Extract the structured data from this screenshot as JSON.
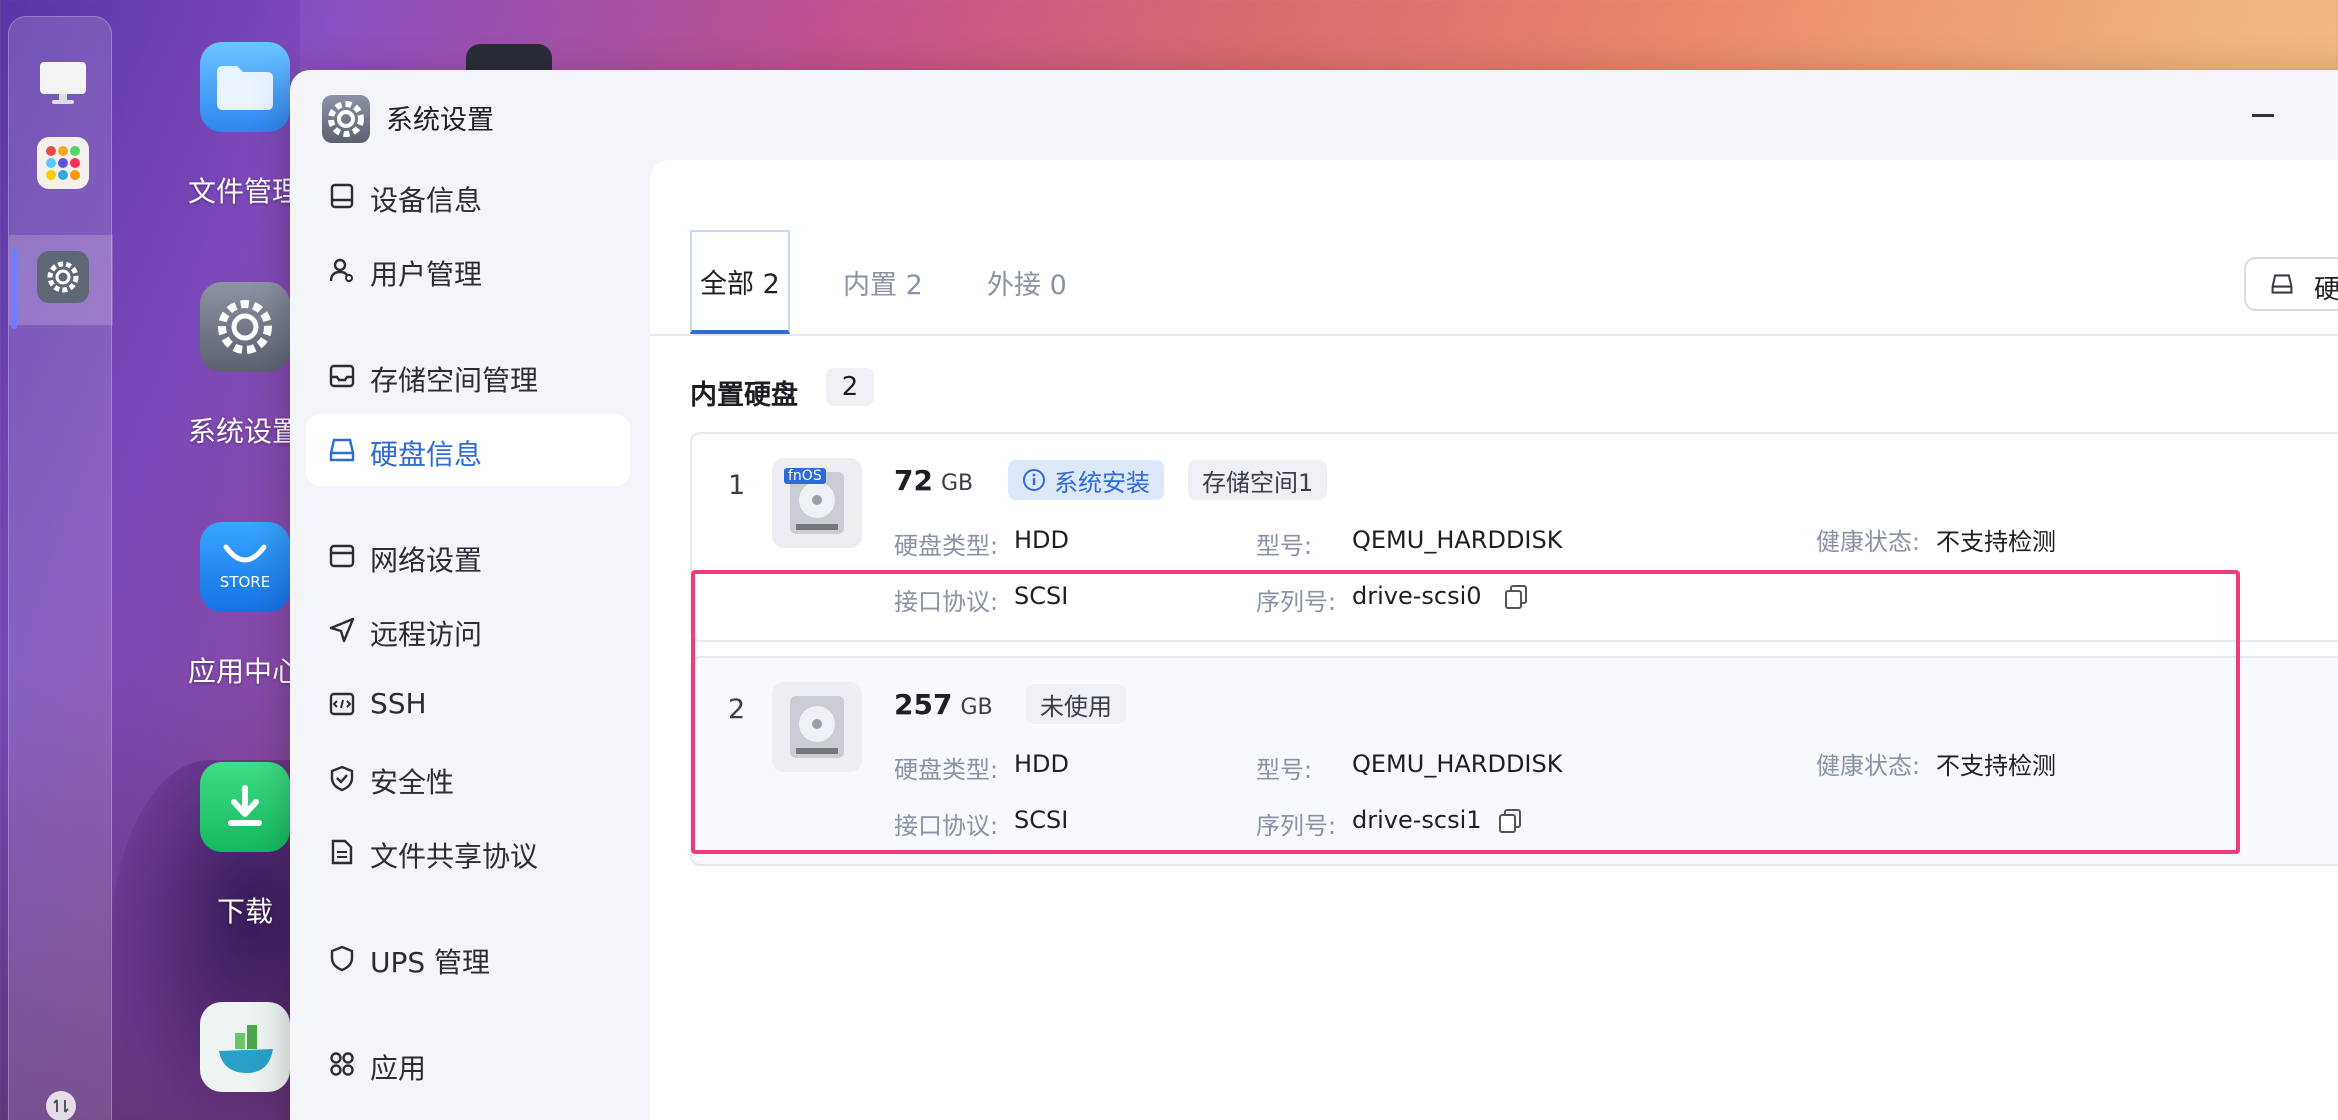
{
  "desktop": {
    "icons": [
      {
        "name": "file-manager",
        "label": "文件管理"
      },
      {
        "name": "system-settings",
        "label": "系统设置"
      },
      {
        "name": "app-center",
        "label": "应用中心",
        "badge": "STORE"
      },
      {
        "name": "download",
        "label": "下载"
      }
    ]
  },
  "window": {
    "title": "系统设置",
    "sidebar": [
      {
        "label": "设备信息",
        "icon": "device-icon"
      },
      {
        "label": "用户管理",
        "icon": "user-icon"
      },
      {
        "label": "存储空间管理",
        "icon": "storage-icon"
      },
      {
        "label": "硬盘信息",
        "icon": "disk-icon",
        "active": true
      },
      {
        "label": "网络设置",
        "icon": "network-icon"
      },
      {
        "label": "远程访问",
        "icon": "send-icon"
      },
      {
        "label": "SSH",
        "icon": "code-icon"
      },
      {
        "label": "安全性",
        "icon": "shield-check-icon"
      },
      {
        "label": "文件共享协议",
        "icon": "document-icon"
      },
      {
        "label": "UPS 管理",
        "icon": "shield-icon"
      },
      {
        "label": "应用",
        "icon": "apps-icon"
      }
    ],
    "tabs": [
      {
        "label": "全部 2",
        "active": true
      },
      {
        "label": "内置 2"
      },
      {
        "label": "外接 0"
      }
    ],
    "right_button_label": "硬",
    "section": {
      "title": "内置硬盘",
      "count": "2"
    },
    "disks": [
      {
        "index": "1",
        "size": "72",
        "unit": "GB",
        "logo": "fnOS",
        "tags": [
          {
            "label": "系统安装",
            "style": "blue",
            "icon": "info-icon"
          },
          {
            "label": "存储空间1",
            "style": "grey"
          }
        ],
        "type_label": "硬盘类型:",
        "type": "HDD",
        "model_label": "型号:",
        "model": "QEMU_HARDDISK",
        "health_label": "健康状态:",
        "health": "不支持检测",
        "iface_label": "接口协议:",
        "iface": "SCSI",
        "serial_label": "序列号:",
        "serial": "drive-scsi0"
      },
      {
        "index": "2",
        "size": "257",
        "unit": "GB",
        "tags": [
          {
            "label": "未使用",
            "style": "grey"
          }
        ],
        "type_label": "硬盘类型:",
        "type": "HDD",
        "model_label": "型号:",
        "model": "QEMU_HARDDISK",
        "health_label": "健康状态:",
        "health": "不支持检测",
        "iface_label": "接口协议:",
        "iface": "SCSI",
        "serial_label": "序列号:",
        "serial": "drive-scsi1"
      }
    ]
  },
  "colors": {
    "accent": "#2f6bd8",
    "highlight": "#ee3d7e"
  }
}
